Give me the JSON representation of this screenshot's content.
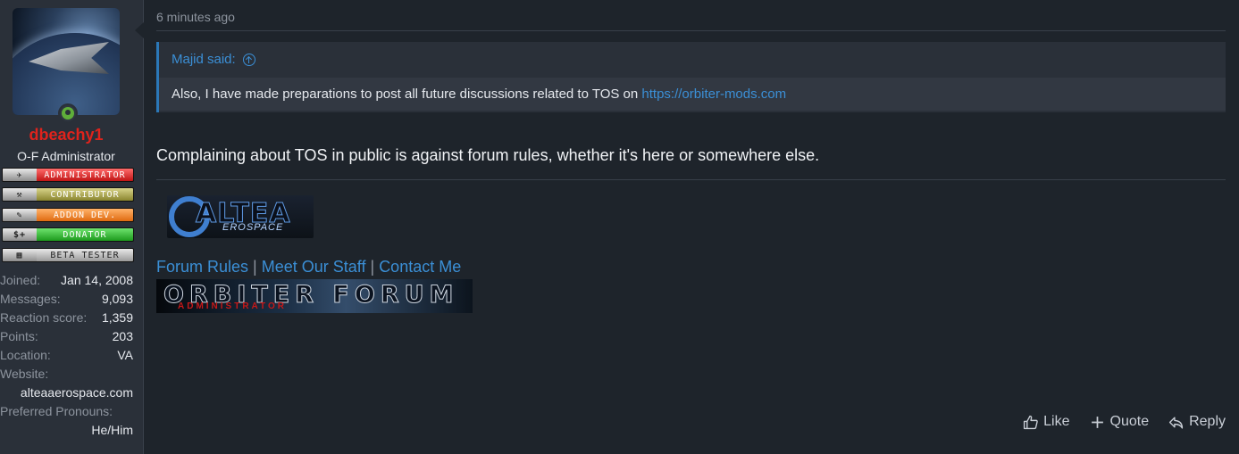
{
  "user": {
    "name": "dbeachy1",
    "title": "O-F Administrator",
    "banners": [
      "Administrator",
      "Contributor",
      "Addon Dev.",
      "Donator",
      "Beta Tester"
    ],
    "stats": {
      "joined_label": "Joined:",
      "joined_value": "Jan 14, 2008",
      "messages_label": "Messages:",
      "messages_value": "9,093",
      "reaction_label": "Reaction score:",
      "reaction_value": "1,359",
      "points_label": "Points:",
      "points_value": "203",
      "location_label": "Location:",
      "location_value": "VA",
      "website_label": "Website:",
      "website_value": "alteaaerospace.com",
      "pronouns_label": "Preferred Pronouns:",
      "pronouns_value": "He/Him"
    }
  },
  "post": {
    "timestamp": "6 minutes ago",
    "quote": {
      "author_said": "Majid said:",
      "text": "Also, I have made preparations to post all future discussions related to TOS on ",
      "link": "https://orbiter-mods.com"
    },
    "message": "Complaining about TOS in public is against forum rules, whether it's here or somewhere else."
  },
  "signature": {
    "altea_logo_word": "ALTEA",
    "altea_logo_sub": "EROSPACE",
    "link_forum_rules": "Forum Rules",
    "link_staff": "Meet Our Staff",
    "link_contact": "Contact Me",
    "separator": "|",
    "banner_title": "ORBITER FORUM",
    "banner_sub": "ADMINISTRATOR"
  },
  "actions": {
    "like": "Like",
    "quote": "Quote",
    "reply": "Reply"
  },
  "colors": {
    "background": "#1e242b",
    "sidebar": "#2a3039",
    "link": "#3b8fd6",
    "username": "#e0231c",
    "online": "#5fae3a"
  }
}
